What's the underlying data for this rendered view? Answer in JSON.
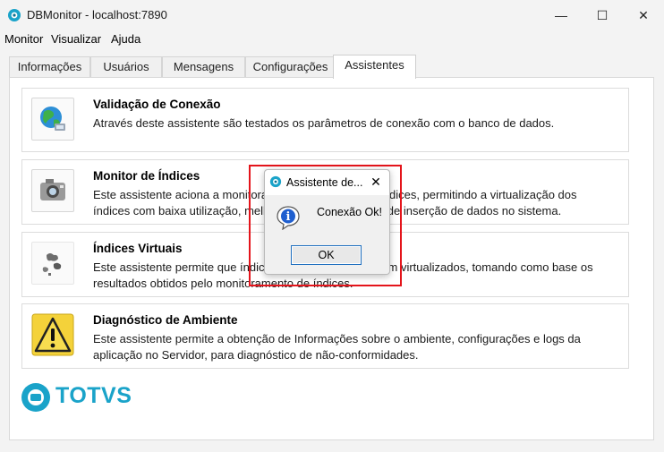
{
  "window": {
    "title": "DBMonitor - localhost:7890",
    "min_glyph": "—",
    "max_glyph": "☐",
    "close_glyph": "✕"
  },
  "menu": [
    "Monitor",
    "Visualizar",
    "Ajuda"
  ],
  "tabs": [
    "Informações",
    "Usuários",
    "Mensagens",
    "Configurações",
    "Assistentes"
  ],
  "active_tab": "Assistentes",
  "cards": [
    {
      "title": "Validação de Conexão",
      "desc": "Através deste assistente são testados os parâmetros de conexão com o banco de dados.",
      "icon": "globe-network-icon"
    },
    {
      "title": "Monitor de Índices",
      "desc": "Este assistente aciona a monitoração dos acessos aos índices, permitindo a virtualização dos índices com baixa utilização, melhorando a performance de inserção de dados no sistema.",
      "icon": "camera-icon"
    },
    {
      "title": "Índices Virtuais",
      "desc": "Este assistente permite que índices pouco utilizados sejam virtualizados, tomando como base os resultados obtidos pelo monitoramento de índices.",
      "icon": "virtual-index-icon"
    },
    {
      "title": "Diagnóstico de Ambiente",
      "desc": "Este assistente permite a obtenção de Informações sobre o ambiente, configurações e logs da aplicação no Servidor, para diagnóstico de não-conformidades.",
      "icon": "warning-icon"
    }
  ],
  "logo": {
    "text": "TOTVS"
  },
  "dialog": {
    "title": "Assistente de...",
    "close_glyph": "✕",
    "message": "Conexão Ok!",
    "ok_label": "OK",
    "info_glyph": "i"
  },
  "colors": {
    "accent": "#1aa3c9",
    "highlight": "#e4141b",
    "button_focus": "#1f6fbf",
    "warning": "#f4d23a"
  }
}
